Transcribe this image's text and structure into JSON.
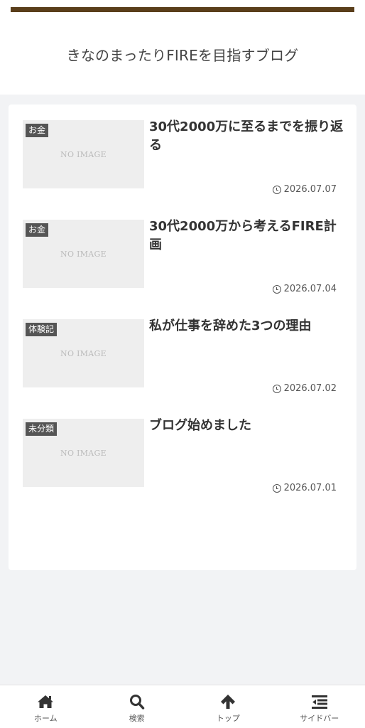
{
  "header": {
    "site_title": "きなのまったりFIREを目指すブログ",
    "accent_color": "#5a3e1b"
  },
  "posts": [
    {
      "category": "お金",
      "title": "30代2000万に至るまでを振り返る",
      "date": "2026.07.07",
      "thumbnail_text": "NO IMAGE"
    },
    {
      "category": "お金",
      "title": "30代2000万から考えるFIRE計画",
      "date": "2026.07.04",
      "thumbnail_text": "NO IMAGE"
    },
    {
      "category": "体験記",
      "title": "私が仕事を辞めた3つの理由",
      "date": "2026.07.02",
      "thumbnail_text": "NO IMAGE"
    },
    {
      "category": "未分類",
      "title": "ブログ始めました",
      "date": "2026.07.01",
      "thumbnail_text": "NO IMAGE"
    }
  ],
  "footer_nav": [
    {
      "label": "ホーム",
      "icon": "home-icon"
    },
    {
      "label": "検索",
      "icon": "search-icon"
    },
    {
      "label": "トップ",
      "icon": "arrow-up-icon"
    },
    {
      "label": "サイドバー",
      "icon": "sidebar-icon"
    }
  ]
}
